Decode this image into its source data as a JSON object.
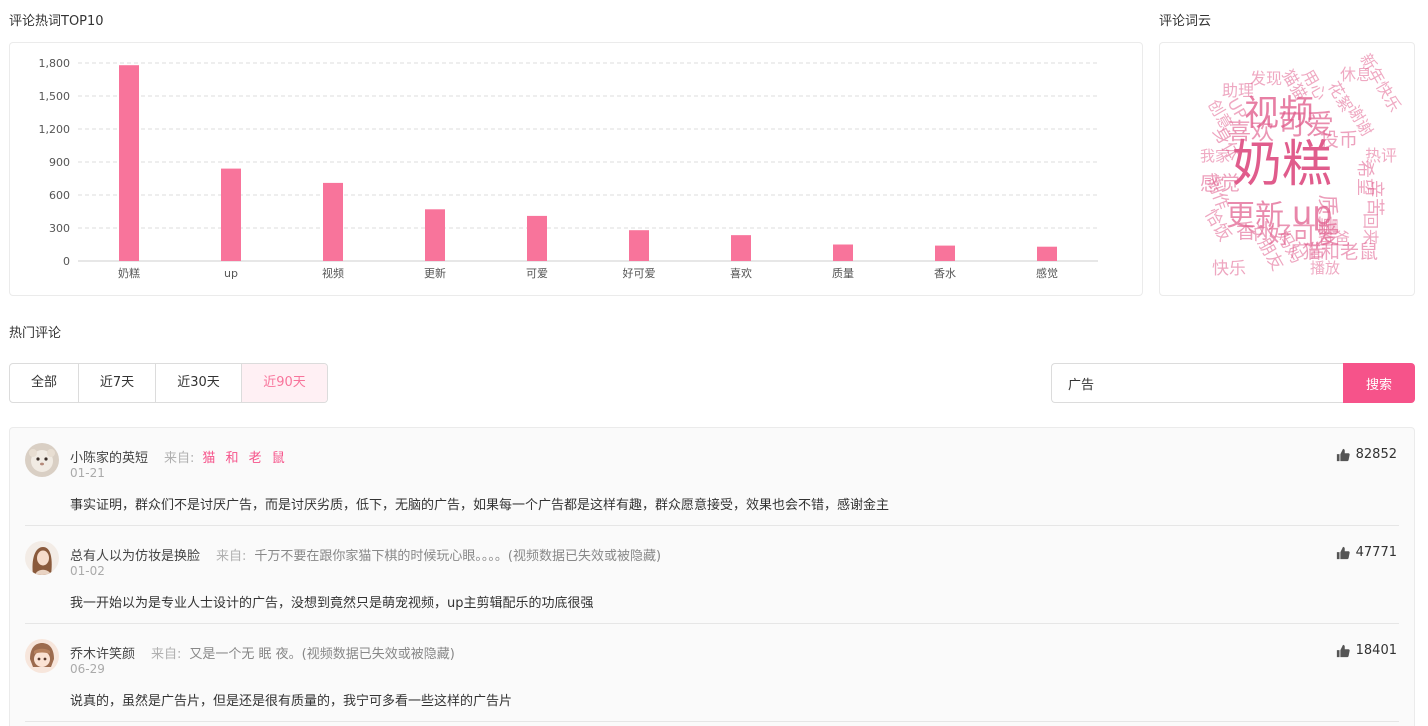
{
  "sections": {
    "top_words_title": "评论热词TOP10",
    "word_cloud_title": "评论词云",
    "hot_comments_title": "热门评论"
  },
  "chart_data": {
    "type": "bar",
    "categories": [
      "奶糕",
      "up",
      "视频",
      "更新",
      "可爱",
      "好可爱",
      "喜欢",
      "质量",
      "香水",
      "感觉"
    ],
    "values": [
      1780,
      840,
      710,
      470,
      410,
      280,
      235,
      150,
      140,
      130
    ],
    "yticks": [
      "0",
      "300",
      "600",
      "900",
      "1,200",
      "1,500",
      "1,800"
    ],
    "ylim": [
      0,
      1800
    ],
    "grid": true,
    "bar_color": "#f8749b"
  },
  "word_cloud": [
    {
      "text": "奶糕",
      "weight": 1.0
    },
    {
      "text": "视频",
      "weight": 0.62
    },
    {
      "text": "up",
      "weight": 0.55
    },
    {
      "text": "更新",
      "weight": 0.48
    },
    {
      "text": "可爱",
      "weight": 0.45
    },
    {
      "text": "好可爱",
      "weight": 0.36
    },
    {
      "text": "喜欢",
      "weight": 0.32
    },
    {
      "text": "质量",
      "weight": 0.28
    },
    {
      "text": "香水",
      "weight": 0.24
    },
    {
      "text": "感觉",
      "weight": 0.24
    },
    {
      "text": "猫和老鼠",
      "weight": 0.22
    },
    {
      "text": "投币",
      "weight": 0.22
    },
    {
      "text": "希望",
      "weight": 0.2
    },
    {
      "text": "辛苦",
      "weight": 0.2
    },
    {
      "text": "身体",
      "weight": 0.2
    },
    {
      "text": "广告",
      "weight": 0.2
    },
    {
      "text": "制作",
      "weight": 0.18
    },
    {
      "text": "恰饭",
      "weight": 0.18
    },
    {
      "text": "女朋友",
      "weight": 0.18
    },
    {
      "text": "妈妈",
      "weight": 0.18
    },
    {
      "text": "快乐",
      "weight": 0.18
    },
    {
      "text": "爸爸",
      "weight": 0.16
    },
    {
      "text": "回来",
      "weight": 0.16
    },
    {
      "text": "助理",
      "weight": 0.16
    },
    {
      "text": "猫猫",
      "weight": 0.16
    },
    {
      "text": "花絮",
      "weight": 0.16
    },
    {
      "text": "新年快乐",
      "weight": 0.15
    },
    {
      "text": "用心",
      "weight": 0.15
    },
    {
      "text": "谢谢",
      "weight": 0.15
    },
    {
      "text": "创意",
      "weight": 0.15
    },
    {
      "text": "发现",
      "weight": 0.14
    },
    {
      "text": "休息",
      "weight": 0.14
    },
    {
      "text": "播放",
      "weight": 0.13
    },
    {
      "text": "我家",
      "weight": 0.13
    },
    {
      "text": "UP",
      "weight": 0.14
    },
    {
      "text": "热评",
      "weight": 0.14
    }
  ],
  "filters": {
    "tabs": [
      {
        "label": "全部"
      },
      {
        "label": "近7天"
      },
      {
        "label": "近30天"
      },
      {
        "label": "近90天"
      }
    ],
    "active_index": 3
  },
  "search": {
    "value": "广告",
    "button_label": "搜索"
  },
  "comments": [
    {
      "user": "小陈家的英短",
      "from_label": "来自:",
      "from": "猫 和 老 鼠",
      "from_pink": true,
      "date": "01-21",
      "text": "事实证明，群众们不是讨厌广告，而是讨厌劣质，低下，无脑的广告，如果每一个广告都是这样有趣，群众愿意接受，效果也会不错，感谢金主",
      "likes": "82852"
    },
    {
      "user": "总有人以为仿妆是换脸",
      "from_label": "来自:",
      "from": "千万不要在跟你家猫下棋的时候玩心眼。。。。(视频数据已失效或被隐藏)",
      "from_pink": false,
      "date": "01-02",
      "text": "我一开始以为是专业人士设计的广告，没想到竟然只是萌宠视频，up主剪辑配乐的功底很强",
      "likes": "47771"
    },
    {
      "user": "乔木许笑颜",
      "from_label": "来自:",
      "from": "又是一个无 眠 夜。(视频数据已失效或被隐藏)",
      "from_pink": false,
      "date": "06-29",
      "text": "说真的，虽然是广告片，但是还是很有质量的，我宁可多看一些这样的广告片",
      "likes": "18401"
    }
  ]
}
